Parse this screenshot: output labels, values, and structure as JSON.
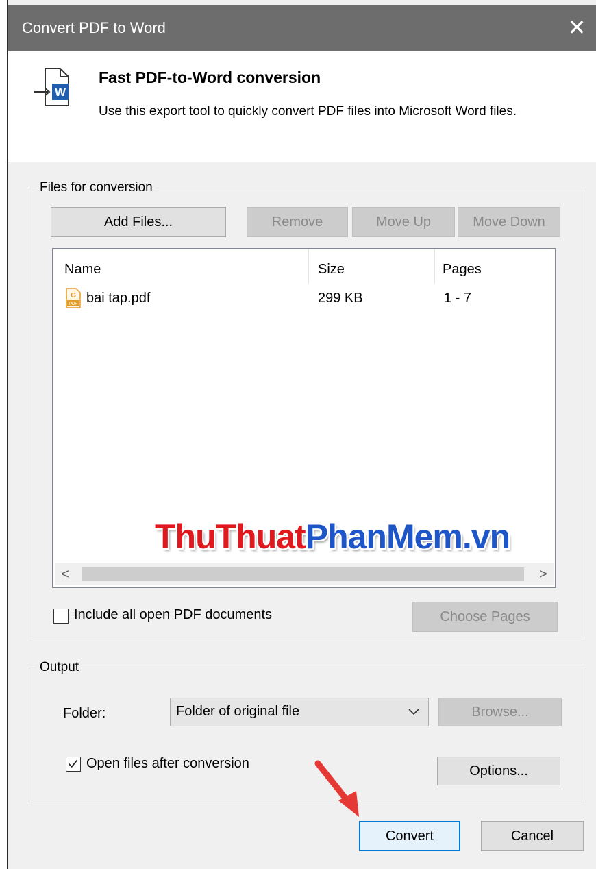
{
  "window": {
    "title": "Convert PDF to Word",
    "close_glyph": "✕",
    "icon": "close-icon"
  },
  "header": {
    "title": "Fast PDF-to-Word conversion",
    "description": "Use this export tool to quickly convert PDF files into Microsoft Word files.",
    "icon": "pdf-to-word-icon"
  },
  "files_group": {
    "label": "Files for conversion",
    "buttons": {
      "add_files": "Add Files...",
      "remove": "Remove",
      "move_up": "Move Up",
      "move_down": "Move Down"
    },
    "columns": {
      "name": "Name",
      "size": "Size",
      "pages": "Pages"
    },
    "rows": [
      {
        "name": "bai tap.pdf",
        "size": "299 KB",
        "pages": "1 - 7",
        "icon": "pdf-file-icon"
      }
    ],
    "scroll_left": "<",
    "scroll_right": ">",
    "include_all_label": "Include all open PDF documents",
    "include_all_checked": false,
    "choose_pages": "Choose Pages"
  },
  "output_group": {
    "label": "Output",
    "folder_label": "Folder:",
    "folder_value": "Folder of original file",
    "browse": "Browse...",
    "open_after_label": "Open files after conversion",
    "open_after_checked": true,
    "options": "Options..."
  },
  "footer": {
    "convert": "Convert",
    "cancel": "Cancel"
  },
  "watermark": {
    "part1": "ThuThuat",
    "part2": "PhanMem.vn",
    "color1": "#e0191f",
    "color2": "#1e56c7"
  },
  "colors": {
    "accent": "#0078d7",
    "titlebar": "#6d6d6d",
    "annotation_arrow": "#e53935"
  }
}
